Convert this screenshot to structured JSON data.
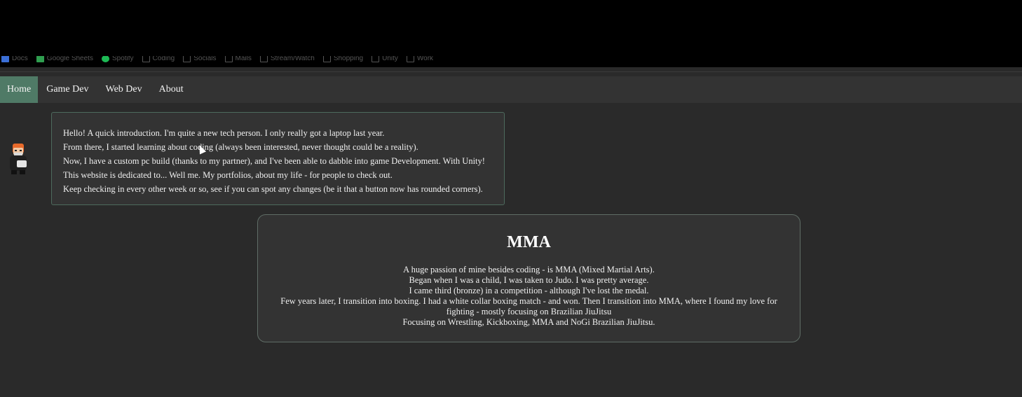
{
  "bookmarks": [
    {
      "label": "Docs",
      "icon": "docs-icon"
    },
    {
      "label": "Google Sheets",
      "icon": "sheets-icon"
    },
    {
      "label": "Spotify",
      "icon": "spotify-icon"
    },
    {
      "label": "Coding",
      "icon": "folder-icon"
    },
    {
      "label": "Socials",
      "icon": "folder-icon"
    },
    {
      "label": "Mails",
      "icon": "folder-icon"
    },
    {
      "label": "Stream/Watch",
      "icon": "folder-icon"
    },
    {
      "label": "Shopping",
      "icon": "folder-icon"
    },
    {
      "label": "Unity",
      "icon": "folder-icon"
    },
    {
      "label": "Work",
      "icon": "folder-icon"
    }
  ],
  "nav": {
    "home": "Home",
    "gamedev": "Game Dev",
    "webdev": "Web Dev",
    "about": "About"
  },
  "intro": {
    "lines": [
      "Hello! A quick introduction. I'm quite a new tech person. I only really got a laptop last year.",
      "From there, I started learning about coding (always been interested, never thought could be a reality).",
      "Now, I have a custom pc build (thanks to my partner), and I've been able to dabble into game Development. With Unity!",
      "This website is dedicated to... Well me. My portfolios, about my life - for people to check out.",
      "Keep checking in every other week or so, see if you can spot any changes (be it that a button now has rounded corners)."
    ]
  },
  "mma": {
    "title": "MMA",
    "lines": [
      "A huge passion of mine besides coding - is MMA (Mixed Martial Arts).",
      "Began when I was a child, I was taken to Judo. I was pretty average.",
      "I came third (bronze) in a competition - although I've lost the medal.",
      "Few years later, I transition into boxing. I had a white collar boxing match - and won. Then I transition into MMA, where I found my love for fighting - mostly focusing on Brazilian JiuJitsu",
      "Focusing on Wrestling, Kickboxing, MMA and NoGi Brazilian JiuJitsu."
    ]
  },
  "colors": {
    "background": "#2a2a2a",
    "panel": "#333333",
    "nav_active": "#4f7a66",
    "intro_border": "#4d6a5d"
  }
}
